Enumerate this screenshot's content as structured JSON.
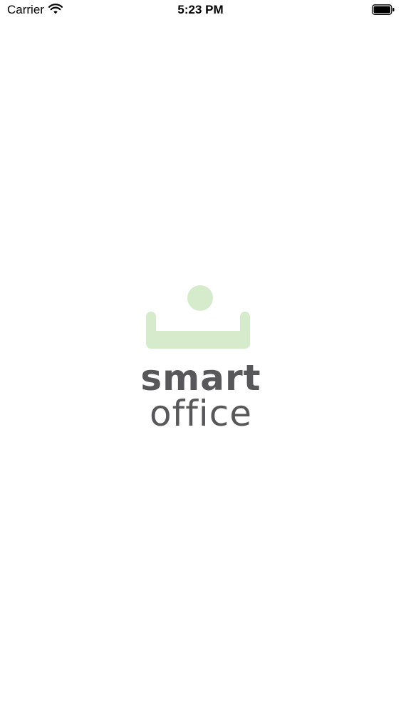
{
  "status_bar": {
    "carrier": "Carrier",
    "time": "5:23 PM",
    "wifi_icon": "wifi-icon",
    "battery_icon": "battery-icon"
  },
  "splash": {
    "logo_icon": "smart-office-logo-icon",
    "brand_line_1": "smart",
    "brand_line_2": "office",
    "logo_color": "#d6ebcc",
    "text_color": "#58575a"
  }
}
